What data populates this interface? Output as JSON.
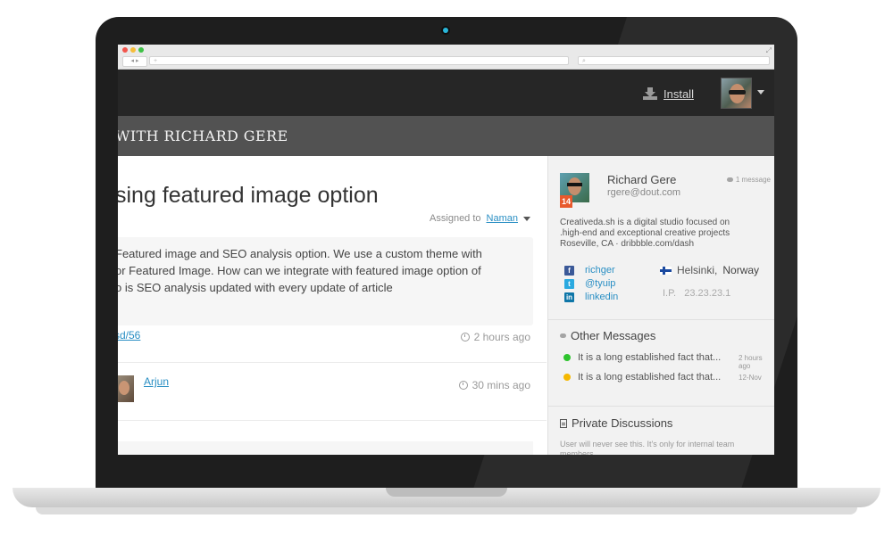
{
  "browser": {
    "address_placeholder": "+",
    "search_placeholder": "⌕",
    "nav": "◂ ▸",
    "expand": "⤢"
  },
  "header": {
    "install_label": "Install",
    "install_icon": "download-icon"
  },
  "banner": {
    "title": "WITH RICHARD GERE"
  },
  "issue": {
    "title": "sing featured image option",
    "assigned_label": "Assigned to",
    "assignee": "Naman",
    "message_lines": [
      "Featured image and SEO analysis option. We use a custom theme with",
      "or Featured Image. How can we integrate with featured image option of",
      "o is SEO analysis updated with every update of article"
    ],
    "link_text": "sd/56",
    "message_time": "2 hours ago",
    "reply_author": "Arjun",
    "reply_time": "30 mins ago"
  },
  "sidebar": {
    "name": "Richard Gere",
    "email": "rgere@dout.com",
    "message_count": "1 message",
    "badge": "14",
    "bio_lines": [
      "Creativeda.sh is a digital studio focused on",
      ".high-end and exceptional creative projects",
      "Roseville, CA · dribbble.com/dash"
    ],
    "social": [
      {
        "icon": "f",
        "label": "richger"
      },
      {
        "icon": "t",
        "label": "@tyuip"
      },
      {
        "icon": "in",
        "label": "linkedin"
      }
    ],
    "location_city": "Helsinki,",
    "location_country": "Norway",
    "ip_label": "I.P.",
    "ip_value": "23.23.23.1",
    "other_messages_title": "Other Messages",
    "other_messages": [
      {
        "text": "It is a long established fact that...",
        "time": "2 hours ago",
        "status_color": "#2ec42e"
      },
      {
        "text": "It is a long established fact that...",
        "time": "12-Nov",
        "status_color": "#f5b800"
      }
    ],
    "private_title": "Private Discussions",
    "private_note": "User will never see this. It's only for internal team members."
  }
}
